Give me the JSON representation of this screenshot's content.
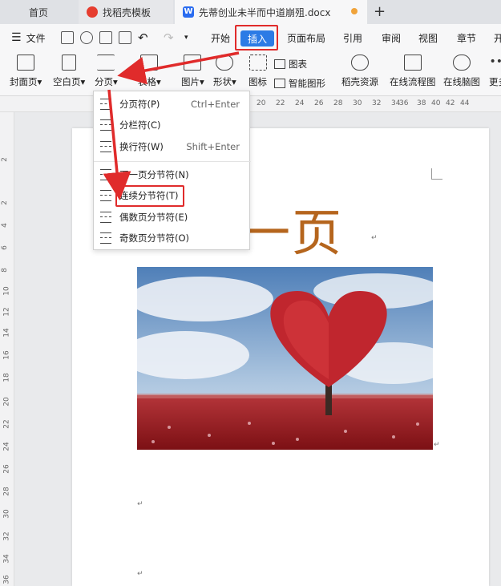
{
  "tabs": {
    "home": "首页",
    "template": "找稻壳模板",
    "doc": "先蒂创业未半而中道崩殂.docx",
    "doc_icon": "W"
  },
  "menubar": {
    "file": "文件",
    "items": [
      "开始",
      "插入",
      "页面布局",
      "引用",
      "审阅",
      "视图",
      "章节",
      "开"
    ]
  },
  "ribbon": {
    "cover": "封面页",
    "blank": "空白页",
    "break": "分页",
    "table": "表格",
    "picture": "图片",
    "shape": "形状",
    "icon": "图标",
    "chart": "图表",
    "smartart": "智能图形",
    "docer": "稻壳资源",
    "flowchart": "在线流程图",
    "mindmap": "在线脑图",
    "more": "更多"
  },
  "dropdown": {
    "items": [
      {
        "label": "分页符(P)",
        "shortcut": "Ctrl+Enter"
      },
      {
        "label": "分栏符(C)",
        "shortcut": ""
      },
      {
        "label": "换行符(W)",
        "shortcut": "Shift+Enter"
      },
      {
        "label": "下一页分节符(N)",
        "shortcut": ""
      },
      {
        "label": "连续分节符(T)",
        "shortcut": ""
      },
      {
        "label": "偶数页分节符(E)",
        "shortcut": ""
      },
      {
        "label": "奇数页分节符(O)",
        "shortcut": ""
      }
    ]
  },
  "ruler": {
    "top": [
      "20",
      "22",
      "24",
      "26",
      "28",
      "30",
      "32",
      "34",
      "36",
      "38",
      "40",
      "42",
      "44"
    ],
    "left": [
      "2",
      "2",
      "4",
      "6",
      "8",
      "10",
      "12",
      "14",
      "16",
      "18",
      "20",
      "22",
      "24",
      "26",
      "28",
      "30",
      "32",
      "34",
      "36"
    ]
  },
  "document": {
    "title": "一页"
  },
  "colors": {
    "accent": "#2c7be5",
    "highlight": "#e02b2b",
    "title": "#b5651d"
  }
}
